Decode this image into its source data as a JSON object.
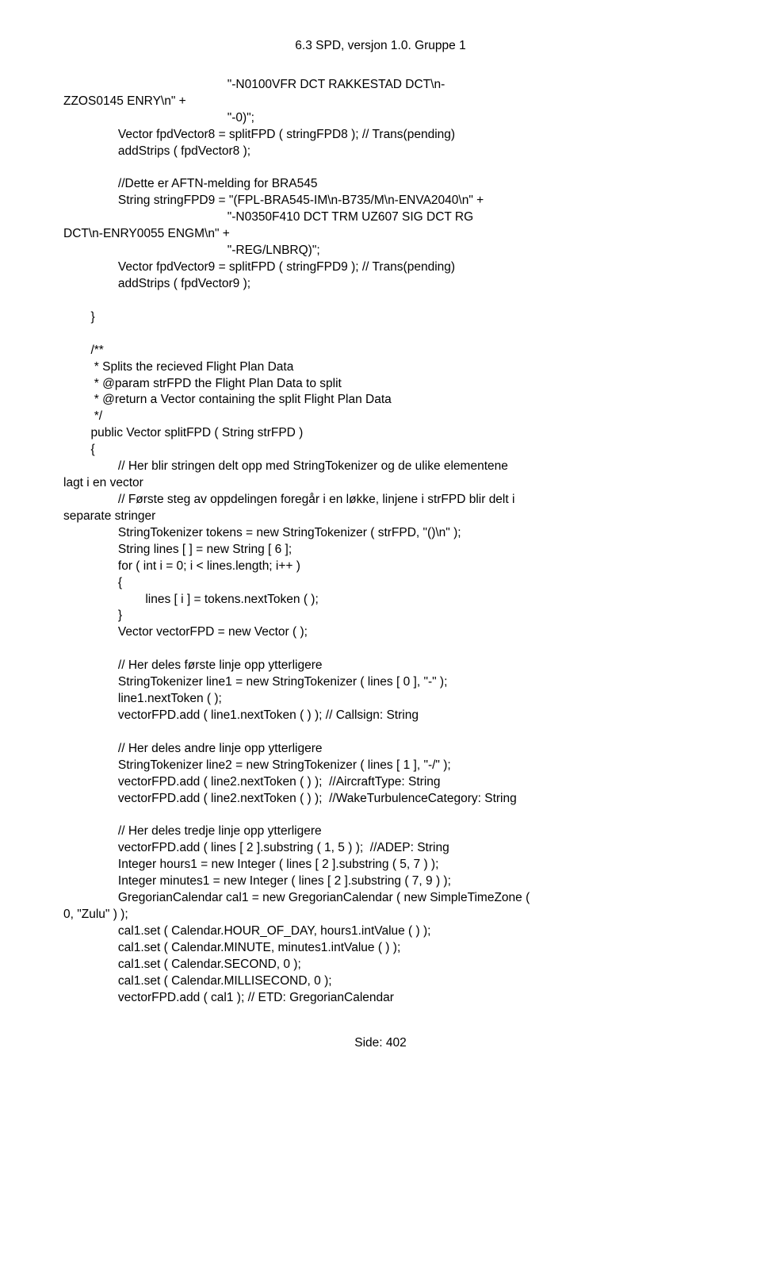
{
  "header": "6.3 SPD, versjon 1.0. Gruppe 1",
  "code": "                                                \"-N0100VFR DCT RAKKESTAD DCT\\n-\nZZOS0145 ENRY\\n\" +\n                                                \"-0)\";\n                Vector fpdVector8 = splitFPD ( stringFPD8 ); // Trans(pending)\n                addStrips ( fpdVector8 );\n\n                //Dette er AFTN-melding for BRA545\n                String stringFPD9 = \"(FPL-BRA545-IM\\n-B735/M\\n-ENVA2040\\n\" +\n                                                \"-N0350F410 DCT TRM UZ607 SIG DCT RG\nDCT\\n-ENRY0055 ENGM\\n\" +\n                                                \"-REG/LNBRQ)\";\n                Vector fpdVector9 = splitFPD ( stringFPD9 ); // Trans(pending)\n                addStrips ( fpdVector9 );\n\n        }\n\n        /**\n         * Splits the recieved Flight Plan Data\n         * @param strFPD the Flight Plan Data to split\n         * @return a Vector containing the split Flight Plan Data\n         */\n        public Vector splitFPD ( String strFPD )\n        {\n                // Her blir stringen delt opp med StringTokenizer og de ulike elementene\nlagt i en vector\n                // Første steg av oppdelingen foregår i en løkke, linjene i strFPD blir delt i\nseparate stringer\n                StringTokenizer tokens = new StringTokenizer ( strFPD, \"()\\n\" );\n                String lines [ ] = new String [ 6 ];\n                for ( int i = 0; i < lines.length; i++ )\n                {\n                        lines [ i ] = tokens.nextToken ( );\n                }\n                Vector vectorFPD = new Vector ( );\n\n                // Her deles første linje opp ytterligere\n                StringTokenizer line1 = new StringTokenizer ( lines [ 0 ], \"-\" );\n                line1.nextToken ( );\n                vectorFPD.add ( line1.nextToken ( ) ); // Callsign: String\n\n                // Her deles andre linje opp ytterligere\n                StringTokenizer line2 = new StringTokenizer ( lines [ 1 ], \"-/\" );\n                vectorFPD.add ( line2.nextToken ( ) );  //AircraftType: String\n                vectorFPD.add ( line2.nextToken ( ) );  //WakeTurbulenceCategory: String\n\n                // Her deles tredje linje opp ytterligere\n                vectorFPD.add ( lines [ 2 ].substring ( 1, 5 ) );  //ADEP: String\n                Integer hours1 = new Integer ( lines [ 2 ].substring ( 5, 7 ) );\n                Integer minutes1 = new Integer ( lines [ 2 ].substring ( 7, 9 ) );\n                GregorianCalendar cal1 = new GregorianCalendar ( new SimpleTimeZone (\n0, \"Zulu\" ) );\n                cal1.set ( Calendar.HOUR_OF_DAY, hours1.intValue ( ) );\n                cal1.set ( Calendar.MINUTE, minutes1.intValue ( ) );\n                cal1.set ( Calendar.SECOND, 0 );\n                cal1.set ( Calendar.MILLISECOND, 0 );\n                vectorFPD.add ( cal1 ); // ETD: GregorianCalendar",
  "footer": "Side: 402"
}
